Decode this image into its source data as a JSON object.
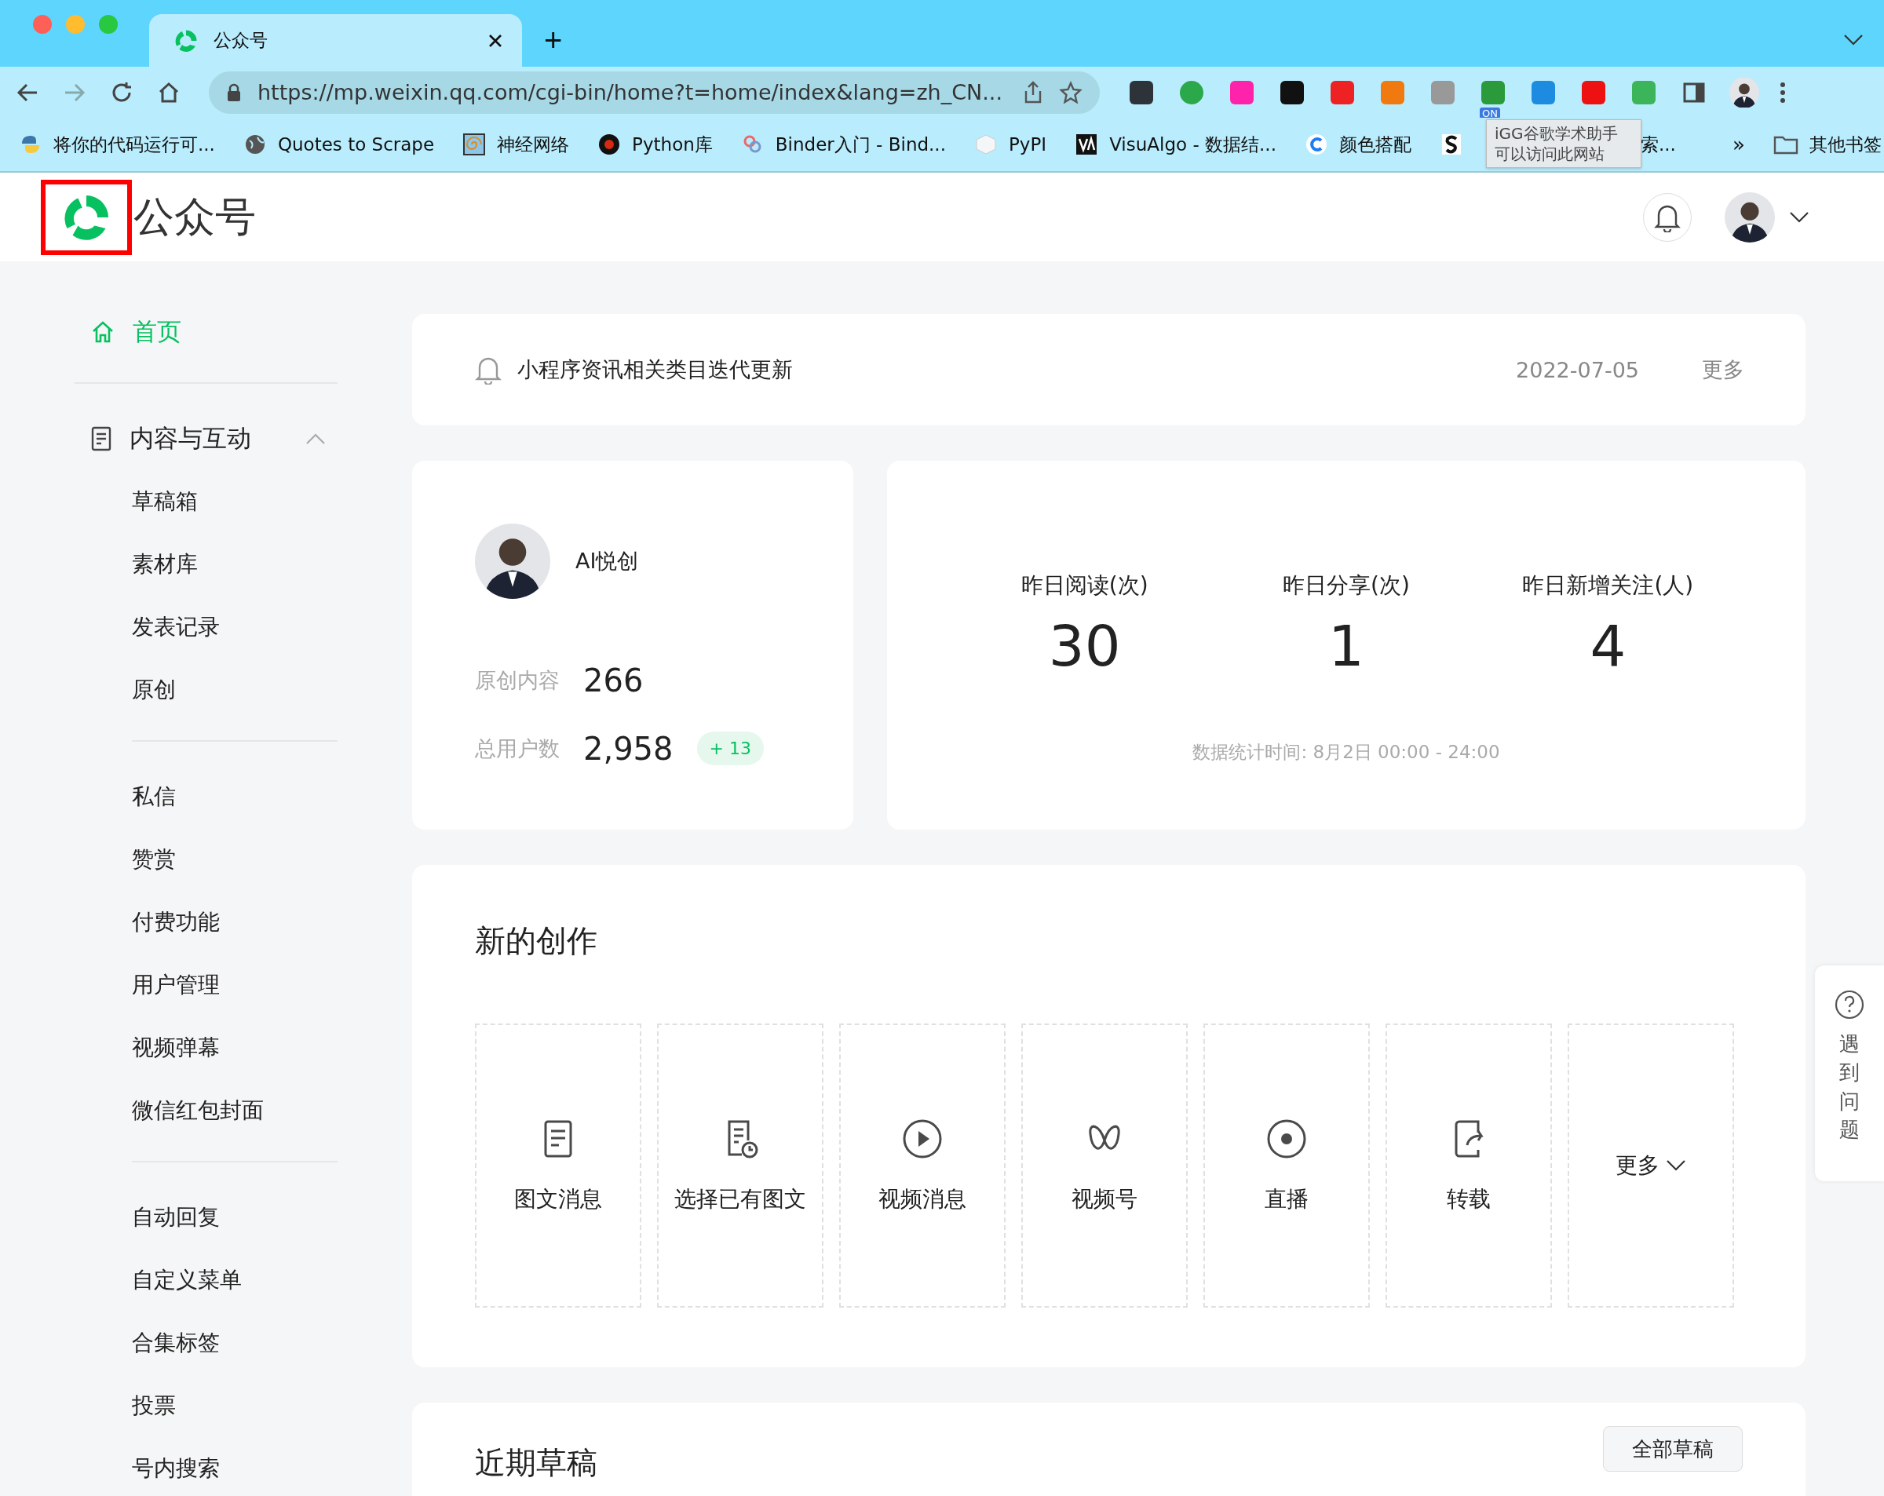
{
  "browser": {
    "tabs": [
      {
        "title": "公众号",
        "selected": true
      }
    ],
    "new_tab": "+",
    "url": "https://mp.weixin.qq.com/cgi-bin/home?t=home/index&lang=zh_CN...",
    "extension_badge": "ON",
    "bookmarks": [
      {
        "kind": "python",
        "label": "将你的代码运行可..."
      },
      {
        "kind": "globe",
        "label": "Quotes to Scrape"
      },
      {
        "kind": "spiral",
        "label": "神经网络"
      },
      {
        "kind": "dark",
        "label": "Python库"
      },
      {
        "kind": "binder",
        "label": "Binder入门 - Bind..."
      },
      {
        "kind": "cube",
        "label": "PyPI"
      },
      {
        "kind": "visualgo",
        "label": "VisuAlgo - 数据结..."
      },
      {
        "kind": "c",
        "label": "颜色搭配"
      },
      {
        "kind": "s",
        "label": "索..."
      }
    ],
    "overflow": "»",
    "other_bookmarks": "其他书签",
    "tooltip": [
      "iGG谷歌学术助手",
      "可以访问此网站"
    ]
  },
  "header": {
    "title": "公众号"
  },
  "sidebar": {
    "home": {
      "label": "首页",
      "selected": true
    },
    "groups": [
      {
        "title": "内容与互动",
        "expanded": true,
        "items": [
          "草稿箱",
          "素材库",
          "发表记录",
          "原创"
        ]
      },
      {
        "items": [
          "私信",
          "赞赏",
          "付费功能",
          "用户管理",
          "视频弹幕",
          "微信红包封面"
        ]
      },
      {
        "items": [
          "自动回复",
          "自定义菜单",
          "合集标签",
          "投票",
          "号内搜索"
        ]
      }
    ]
  },
  "notice": {
    "text": "小程序资讯相关类目迭代更新",
    "date": "2022-07-05",
    "more": "更多"
  },
  "profile": {
    "name": "AI悦创",
    "stats": [
      {
        "label": "原创内容",
        "value": "266"
      },
      {
        "label": "总用户数",
        "value": "2,958",
        "badge": "+ 13"
      }
    ]
  },
  "stats": {
    "metrics": [
      {
        "label": "昨日阅读(次)",
        "value": "30"
      },
      {
        "label": "昨日分享(次)",
        "value": "1"
      },
      {
        "label": "昨日新增关注(人)",
        "value": "4"
      }
    ],
    "footnote": "数据统计时间: 8月2日 00:00 - 24:00"
  },
  "creation": {
    "title": "新的创作",
    "tiles": [
      {
        "kind": "article",
        "label": "图文消息"
      },
      {
        "kind": "pick",
        "label": "选择已有图文"
      },
      {
        "kind": "video",
        "label": "视频消息"
      },
      {
        "kind": "channels",
        "label": "视频号"
      },
      {
        "kind": "live",
        "label": "直播"
      },
      {
        "kind": "repost",
        "label": "转载"
      },
      {
        "kind": "more",
        "label": "更多"
      }
    ]
  },
  "drafts": {
    "title": "近期草稿",
    "button": "全部草稿"
  },
  "help": {
    "text": "遇到问题"
  }
}
